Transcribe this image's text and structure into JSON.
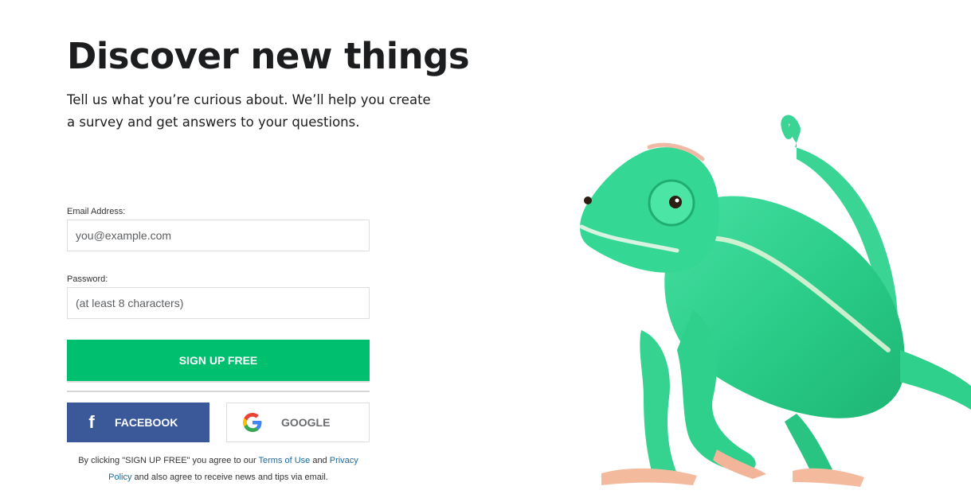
{
  "hero": {
    "title": "Discover new things",
    "subtitle": "Tell us what you’re curious about. We’ll help you create a survey and get answers to your questions."
  },
  "form": {
    "email_label": "Email Address:",
    "email_placeholder": "you@example.com",
    "password_label": "Password:",
    "password_placeholder": "(at least 8 characters)",
    "signup_label": "SIGN UP FREE"
  },
  "social": {
    "facebook_label": "FACEBOOK",
    "facebook_icon": "facebook-icon",
    "google_label": "GOOGLE",
    "google_icon": "google-icon"
  },
  "legal": {
    "prefix": "By clicking \"SIGN UP FREE\" you agree to our ",
    "terms_link": "Terms of Use",
    "and": " and ",
    "privacy_link": "Privacy Policy",
    "suffix": " and also agree to receive news and tips via email."
  },
  "colors": {
    "accent": "#00bf6f",
    "facebook": "#3b5998",
    "link": "#1d6a9b",
    "chameleon": "#2fd48e"
  }
}
